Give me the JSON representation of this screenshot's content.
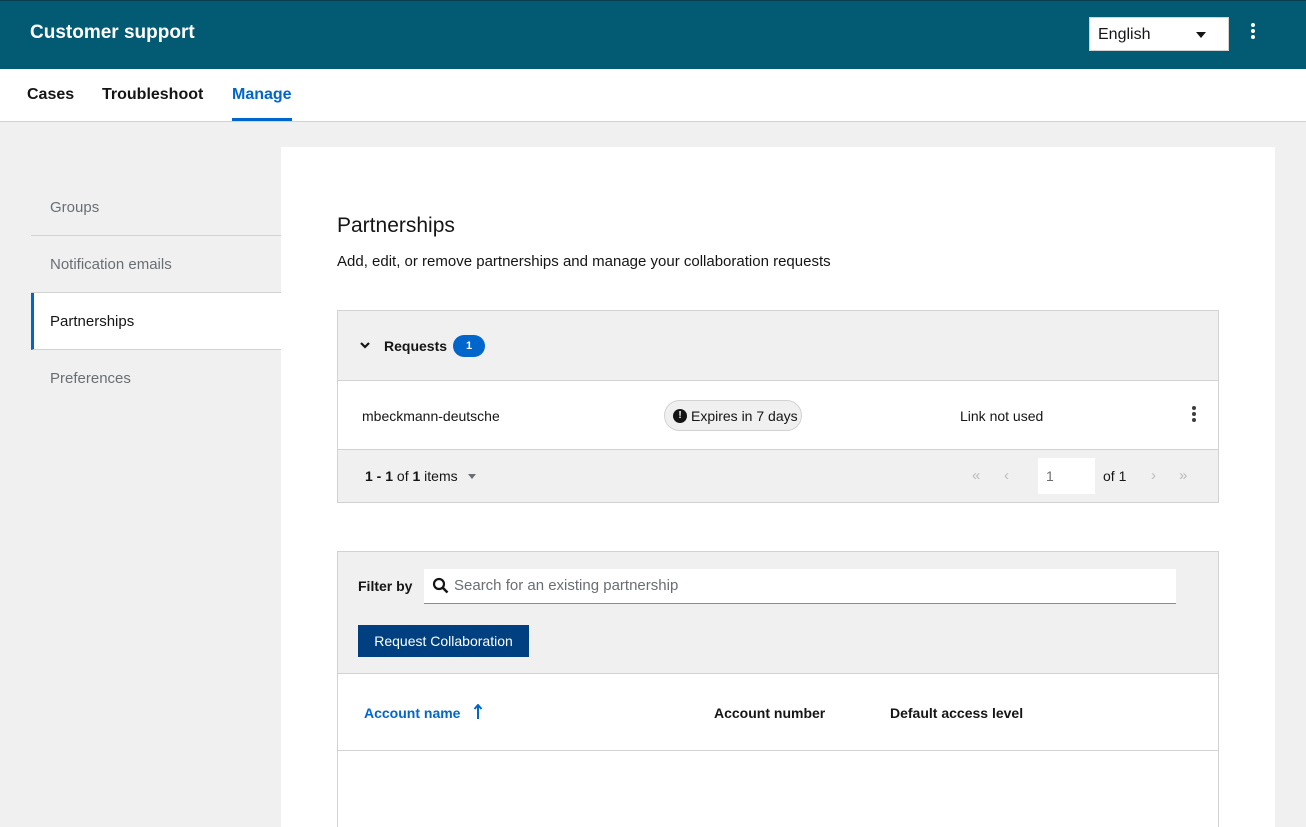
{
  "header": {
    "title": "Customer support",
    "language": "English"
  },
  "tabs": [
    {
      "label": "Cases"
    },
    {
      "label": "Troubleshoot"
    },
    {
      "label": "Manage"
    }
  ],
  "sidebar": {
    "items": [
      {
        "label": "Groups"
      },
      {
        "label": "Notification emails"
      },
      {
        "label": "Partnerships"
      },
      {
        "label": "Preferences"
      }
    ]
  },
  "main": {
    "title": "Partnerships",
    "subtitle": "Add, edit, or remove partnerships and manage your collaboration requests",
    "requests": {
      "label": "Requests",
      "count": "1",
      "rows": [
        {
          "account": "mbeckmann-deutsche",
          "expires": "Expires in 7 days",
          "status": "Link not used"
        }
      ],
      "pagination": {
        "range": "1 - 1",
        "of_word": "of",
        "total": "1",
        "items_word": "items",
        "page": "1",
        "of_pages": "of 1"
      }
    },
    "partnerships": {
      "filter_label": "Filter by",
      "search_placeholder": "Search for an existing partnership",
      "request_button": "Request Collaboration",
      "columns": [
        "Account name",
        "Account number",
        "Default access level"
      ]
    }
  },
  "colors": {
    "header_bg": "#035a73",
    "accent": "#0066cc",
    "primary_button": "#004080"
  },
  "icons": {
    "expires": "exclamation-circle-icon",
    "search": "search-icon",
    "sort": "sort-ascending-icon",
    "toggle": "chevron-down-icon",
    "menu": "kebab-icon"
  }
}
